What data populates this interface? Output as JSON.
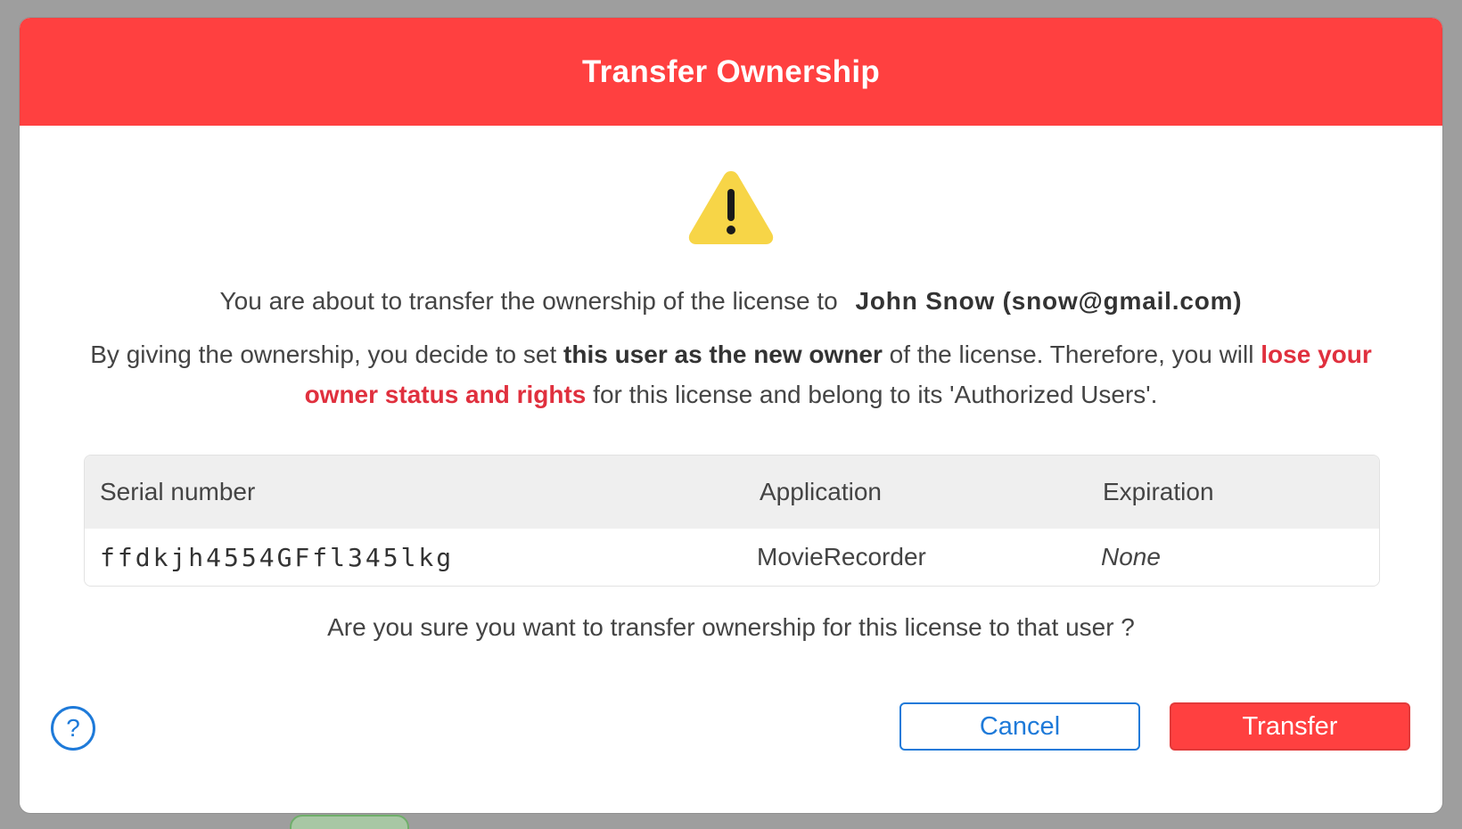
{
  "dialog": {
    "title": "Transfer Ownership",
    "intro_text": "You are about to transfer the ownership of the license to",
    "recipient": "John Snow (snow@gmail.com)",
    "para_part1": "By giving the ownership, you decide to set ",
    "para_strong": "this user as the new owner",
    "para_part2": " of the license. Therefore, you will ",
    "para_danger": "lose your owner status and rights",
    "para_part3": " for this license and belong to its 'Authorized Users'.",
    "confirm_text": "Are you sure you want to transfer ownership for this license to that user ?"
  },
  "table": {
    "headers": [
      "Serial number",
      "Application",
      "Expiration"
    ],
    "rows": [
      [
        "ffdkjh4554GFfl345lkg",
        "MovieRecorder",
        "None"
      ]
    ]
  },
  "buttons": {
    "help": "?",
    "cancel": "Cancel",
    "transfer": "Transfer"
  },
  "icons": {
    "warning": "warning-triangle-icon",
    "help": "help-circle-icon"
  },
  "colors": {
    "header_bg": "#ff4040",
    "danger_text": "#e0303e",
    "accent_blue": "#1e7ad9",
    "warning_yellow": "#f7d547"
  }
}
